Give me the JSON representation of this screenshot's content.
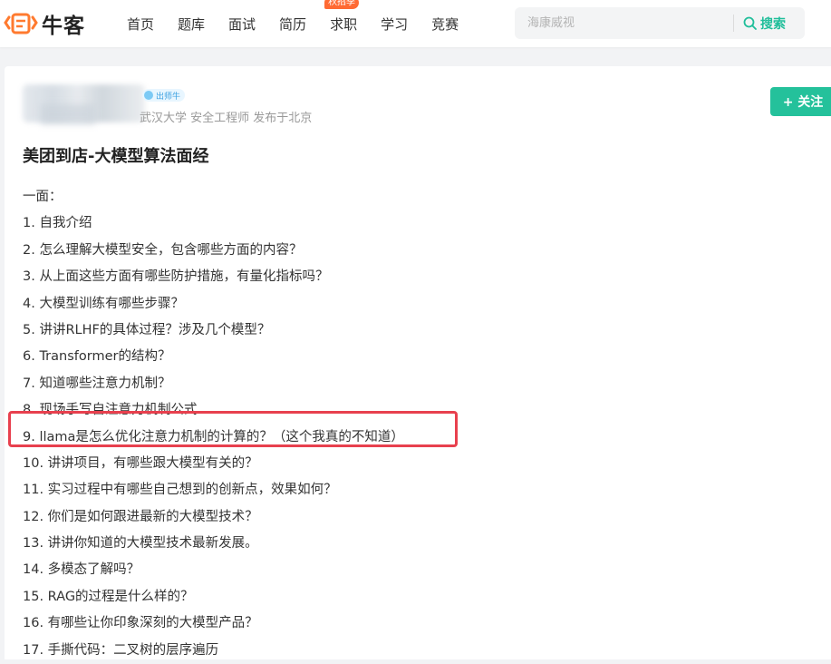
{
  "logo": {
    "text": "牛客"
  },
  "nav": [
    {
      "label": "首页"
    },
    {
      "label": "题库"
    },
    {
      "label": "面试"
    },
    {
      "label": "简历"
    },
    {
      "label": "求职",
      "badge": "秋招季"
    },
    {
      "label": "学习"
    },
    {
      "label": "竞赛"
    }
  ],
  "search": {
    "placeholder": "海康威视",
    "button_label": "搜索"
  },
  "post": {
    "author_badge": "出师牛",
    "meta": "武汉大学 安全工程师   发布于北京",
    "follow_label": "+ 关注",
    "title": "美团到店-大模型算法面经",
    "lines": [
      "一面：",
      "1. 自我介绍",
      "2. 怎么理解大模型安全，包含哪些方面的内容？",
      "3. 从上面这些方面有哪些防护措施，有量化指标吗？",
      "4. 大模型训练有哪些步骤？",
      "5. 讲讲RLHF的具体过程？涉及几个模型？",
      "6. Transformer的结构？",
      "7. 知道哪些注意力机制？",
      "8. 现场手写自注意力机制公式",
      "9. llama是怎么优化注意力机制的计算的？（这个我真的不知道）",
      "10. 讲讲项目，有哪些跟大模型有关的？",
      "11. 实习过程中有哪些自己想到的创新点，效果如何？",
      "12. 你们是如何跟进最新的大模型技术？",
      "13. 讲讲你知道的大模型技术最新发展。",
      "14. 多模态了解吗？",
      "15. RAG的过程是什么样的？",
      "16. 有哪些让你印象深刻的大模型产品？",
      "17. 手撕代码：二叉树的层序遍历"
    ]
  },
  "colors": {
    "accent": "#24c19b",
    "highlight_border": "#e8404e",
    "badge": "#ff6a33"
  }
}
